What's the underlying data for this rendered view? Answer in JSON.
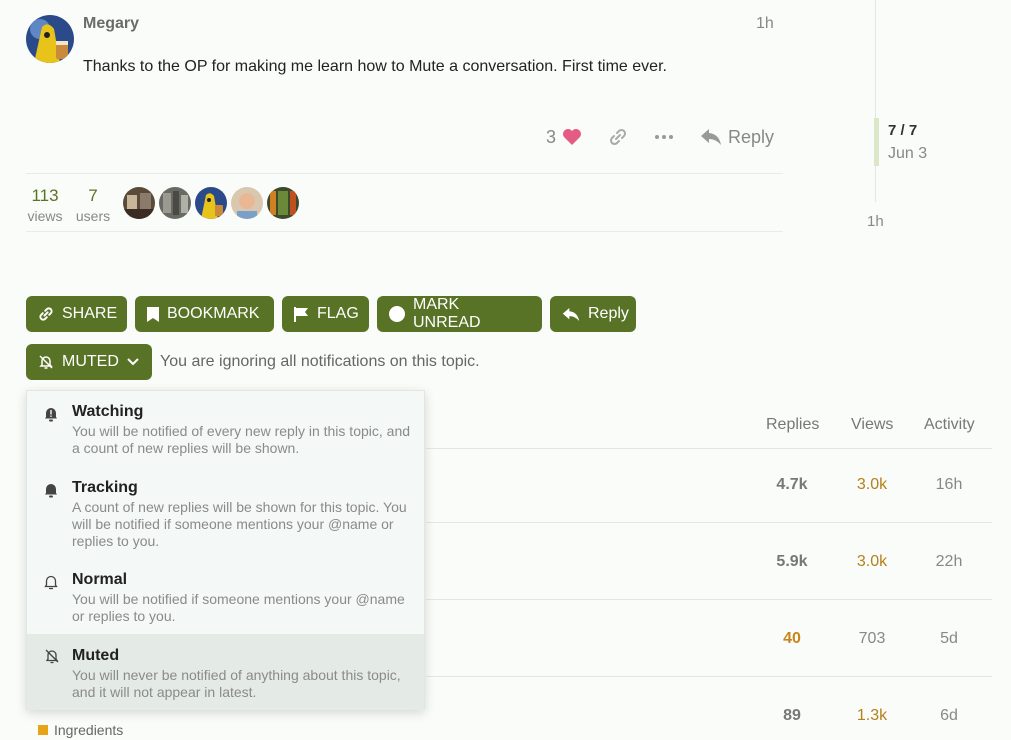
{
  "post": {
    "username": "Megary",
    "time": "1h",
    "body": "Thanks to the OP for making me learn how to Mute a conversation. First time ever.",
    "like_count": "3",
    "reply_label": "Reply"
  },
  "topic_stats": {
    "views_count": "113",
    "views_label": "views",
    "users_count": "7",
    "users_label": "users"
  },
  "timeline": {
    "count": "7 / 7",
    "date": "Jun 3",
    "bottom": "1h"
  },
  "footer_buttons": {
    "share": "SHARE",
    "bookmark": "BOOKMARK",
    "flag": "FLAG",
    "mark_unread": "MARK UNREAD",
    "reply": "Reply"
  },
  "notifications": {
    "current_label": "MUTED",
    "description": "You are ignoring all notifications on this topic.",
    "options": [
      {
        "title": "Watching",
        "desc": "You will be notified of every new reply in this topic, and a count of new replies will be shown."
      },
      {
        "title": "Tracking",
        "desc": "A count of new replies will be shown for this topic. You will be notified if someone mentions your @name or replies to you."
      },
      {
        "title": "Normal",
        "desc": "You will be notified if someone mentions your @name or replies to you."
      },
      {
        "title": "Muted",
        "desc": "You will never be notified of anything about this topic, and it will not appear in latest."
      }
    ]
  },
  "topic_list": {
    "headers": {
      "replies": "Replies",
      "views": "Views",
      "activity": "Activity"
    },
    "rows": [
      {
        "replies": "4.7k",
        "views": "3.0k",
        "activity": "16h"
      },
      {
        "replies": "5.9k",
        "views": "3.0k",
        "activity": "22h"
      },
      {
        "replies": "40",
        "views": "703",
        "activity": "5d"
      },
      {
        "replies": "89",
        "views": "1.3k",
        "activity": "6d"
      }
    ],
    "category": "Ingredients"
  },
  "colors": {
    "accent": "#587326",
    "heart": "#e45c84",
    "views_hot": "#b5801b",
    "replies_hot": "#c7851e",
    "category": "#e8a317"
  }
}
